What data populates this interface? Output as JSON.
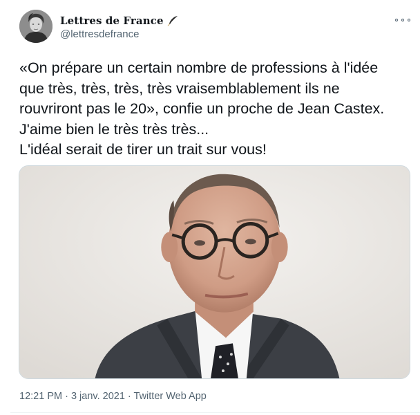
{
  "author": {
    "display_name": "Lettres de France",
    "handle": "@lettresdefrance",
    "badge_icon": "quill-pen-icon"
  },
  "menu": {
    "icon": "more-options-icon"
  },
  "tweet": {
    "lines": [
      "«On prépare un certain nombre de professions à l'idée",
      "que très, très, très, très vraisemblablement ils ne",
      "rouvriront pas le 20», confie un proche de Jean Castex.",
      "J'aime bien le très très très...",
      "L'idéal serait de tirer un trait sur vous!"
    ]
  },
  "media": {
    "alt": "photo"
  },
  "meta": {
    "time": "12:21 PM",
    "separator1": " · ",
    "date": "3 janv. 2021",
    "separator2": " · ",
    "source": "Twitter Web App"
  },
  "colors": {
    "text": "#0f1419",
    "secondary": "#536471",
    "border": "#cfd9de"
  }
}
